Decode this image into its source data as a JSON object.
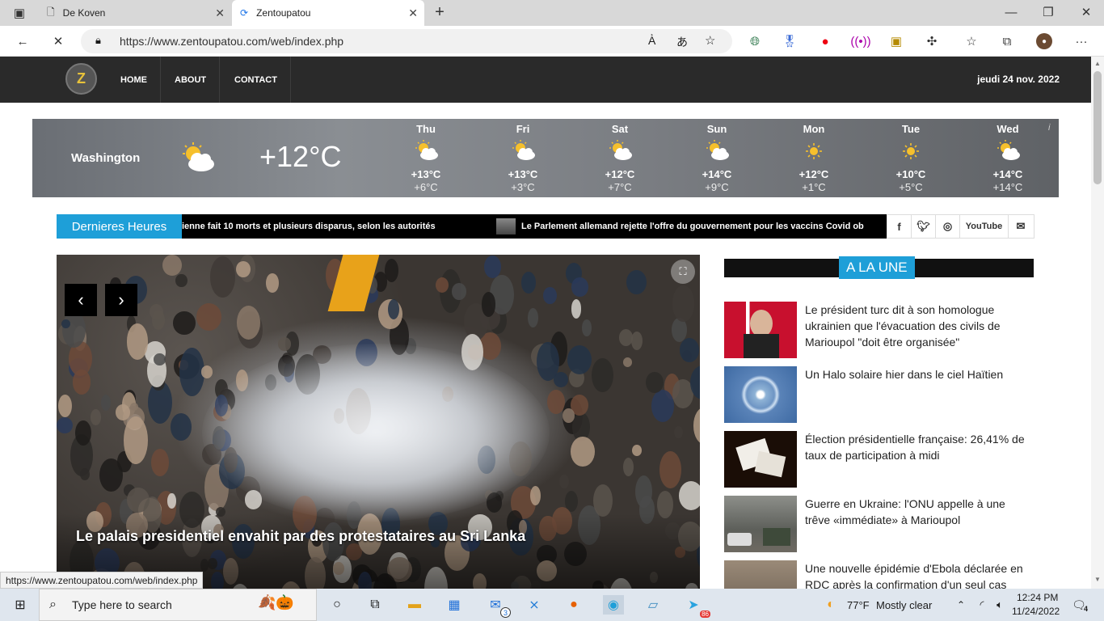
{
  "browser": {
    "tabs": [
      {
        "label": "De Koven"
      },
      {
        "label": "Zentoupatou"
      }
    ],
    "url": "https://www.zentoupatou.com/web/index.php"
  },
  "site": {
    "nav": [
      "HOME",
      "ABOUT",
      "CONTACT"
    ],
    "date": "jeudi 24 nov. 2022"
  },
  "weather": {
    "city": "Washington",
    "current_temp": "+12°C",
    "info_mark": "i",
    "days": [
      {
        "name": "Thu",
        "hi": "+13°C",
        "lo": "+6°C",
        "icon": "partly-cloudy"
      },
      {
        "name": "Fri",
        "hi": "+13°C",
        "lo": "+3°C",
        "icon": "partly-cloudy"
      },
      {
        "name": "Sat",
        "hi": "+12°C",
        "lo": "+7°C",
        "icon": "partly-cloudy"
      },
      {
        "name": "Sun",
        "hi": "+14°C",
        "lo": "+9°C",
        "icon": "partly-cloudy"
      },
      {
        "name": "Mon",
        "hi": "+12°C",
        "lo": "+1°C",
        "icon": "sunny"
      },
      {
        "name": "Tue",
        "hi": "+10°C",
        "lo": "+5°C",
        "icon": "sunny"
      },
      {
        "name": "Wed",
        "hi": "+14°C",
        "lo": "+14°C",
        "icon": "partly-cloudy"
      }
    ]
  },
  "breaking": {
    "label": "Dernieres Heures",
    "items": [
      "ienne fait 10 morts et plusieurs disparus, selon les autorités",
      "Le Parlement allemand rejette l'offre du gouvernement pour les vaccins Covid ob"
    ],
    "socials": [
      "f",
      "t",
      "ig",
      "YouTube",
      "mail"
    ]
  },
  "hero": {
    "title": "Le palais presidentiel envahit par des protestataires au Sri Lanka",
    "prev": "‹",
    "next": "›"
  },
  "sidebar": {
    "heading": "A LA UNE",
    "news": [
      "Le président turc dit à son homologue ukrainien que l'évacuation des civils de Marioupol \"doit être organisée\"",
      "Un Halo solaire hier dans le ciel Haïtien",
      "Élection présidentielle française: 26,41% de taux de participation à midi",
      "Guerre en Ukraine: l'ONU appelle à une trêve «immédiate» à Marioupol",
      "Une nouvelle épidémie d'Ebola déclarée en RDC après la confirmation d'un seul cas"
    ]
  },
  "statusbar": {
    "url": "https://www.zentoupatou.com/web/index.php"
  },
  "taskbar": {
    "search_placeholder": "Type here to search",
    "weather": "77°F",
    "weather_desc": "Mostly clear",
    "time": "12:24 PM",
    "date": "11/24/2022",
    "mail_badge": "3",
    "telegram_badge": "86",
    "notif_count": "4"
  },
  "colors": {
    "accent": "#1e9fd8",
    "header_bg": "#2a2a2a"
  }
}
